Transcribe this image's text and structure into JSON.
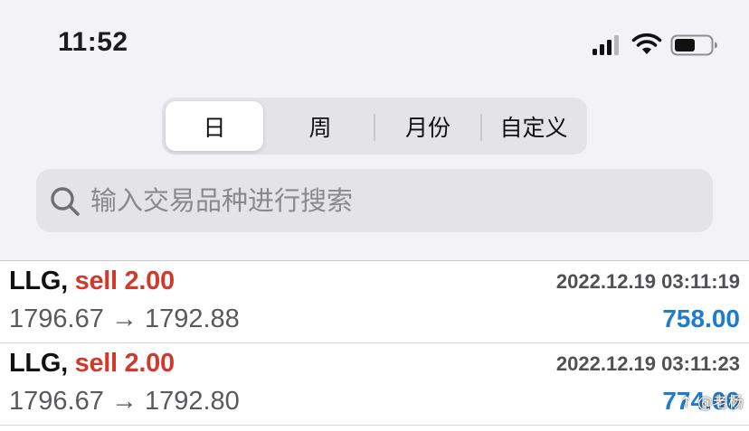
{
  "status_bar": {
    "time": "11:52",
    "icons": [
      "signal-icon",
      "wifi-icon",
      "battery-icon"
    ]
  },
  "segmented": {
    "selected": 0,
    "tabs": [
      {
        "label": "日"
      },
      {
        "label": "周"
      },
      {
        "label": "月份"
      },
      {
        "label": "自定义"
      }
    ]
  },
  "search": {
    "placeholder": "输入交易品种进行搜索",
    "value": "",
    "icon": "search-icon"
  },
  "colors": {
    "sell": "#d0392b",
    "profit": "#1e7ccf",
    "background": "#f2f2f7"
  },
  "trades": [
    {
      "symbol": "LLG,",
      "side": "sell 2.00",
      "time": "2022.12.19 03:11:19",
      "prices": "1796.67 → 1792.88",
      "profit": "758.00"
    },
    {
      "symbol": "LLG,",
      "side": "sell 2.00",
      "time": "2022.12.19 03:11:23",
      "prices": "1796.67 → 1792.80",
      "profit": "774.00"
    }
  ],
  "watermark": "↑ @老杨"
}
